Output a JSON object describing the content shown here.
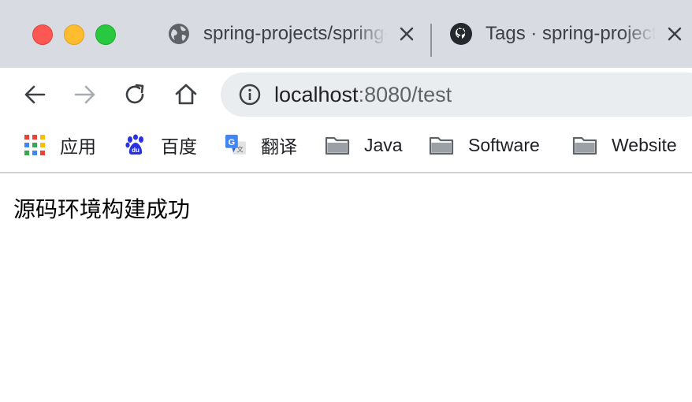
{
  "window": {
    "controls": [
      "close",
      "minimize",
      "zoom"
    ]
  },
  "tabs": [
    {
      "title": "spring-projects/spring-framework",
      "icon": "globe-icon"
    },
    {
      "title": "Tags · spring-projects/spring-framework",
      "icon": "github-icon"
    }
  ],
  "toolbar": {
    "back_icon": "back-arrow-icon",
    "forward_icon": "forward-arrow-icon",
    "reload_icon": "reload-icon",
    "home_icon": "home-icon"
  },
  "omnibox": {
    "host": "localhost",
    "rest": ":8080/test",
    "icon": "info-icon"
  },
  "bookmarks": [
    {
      "label": "应用",
      "icon": "apps-grid-icon"
    },
    {
      "label": "百度",
      "icon": "baidu-paw-icon"
    },
    {
      "label": "翻译",
      "icon": "google-translate-icon"
    },
    {
      "label": "Java",
      "icon": "folder-icon"
    },
    {
      "label": "Software",
      "icon": "folder-icon"
    },
    {
      "label": "Website",
      "icon": "folder-icon"
    }
  ],
  "page": {
    "text": "源码环境构建成功"
  },
  "colors": {
    "tabstrip_bg": "#d8dbe1",
    "omnibox_bg": "#eaedf0",
    "close_red": "#fd5753",
    "minimize_yellow": "#febc2e",
    "zoom_green": "#28c840"
  }
}
